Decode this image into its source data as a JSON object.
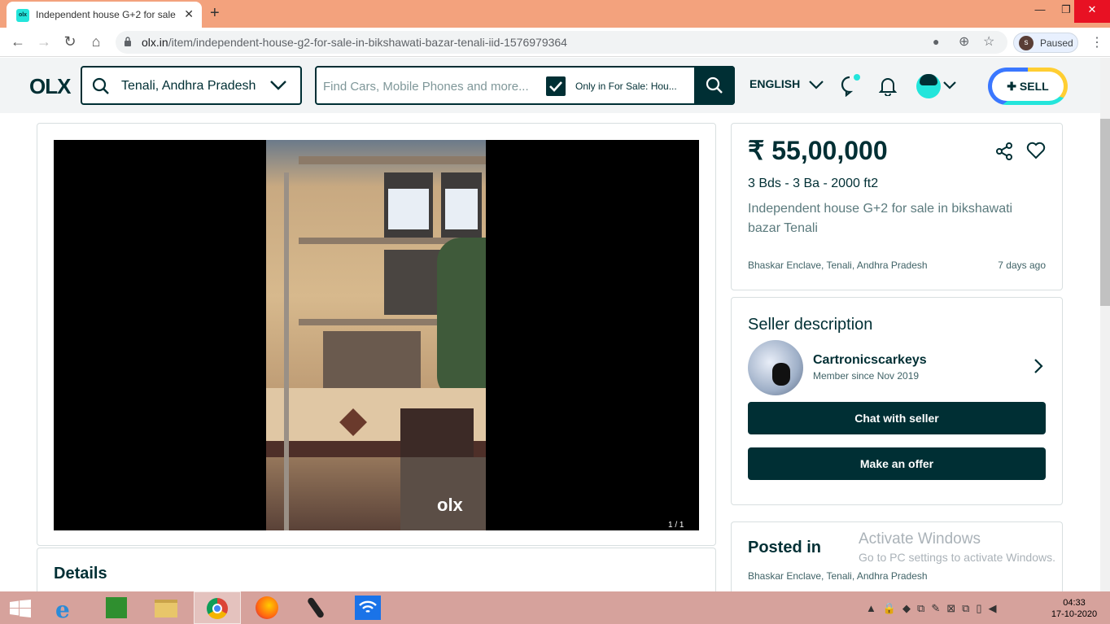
{
  "browser": {
    "tab_title": "Independent house G+2 for sale",
    "favicon_text": "olx",
    "url_host": "olx.in",
    "url_path": "/item/independent-house-g2-for-sale-in-bikshawati-bazar-tenali-iid-1576979364",
    "profile_initial": "s",
    "profile_status": "Paused"
  },
  "header": {
    "logo": "OLX",
    "location": "Tenali, Andhra Pradesh",
    "search_placeholder": "Find Cars, Mobile Phones and more...",
    "only_in_label": "Only in For Sale: Hou...",
    "language": "ENGLISH",
    "sell_label": "SELL"
  },
  "listing": {
    "photo_counter": "1 / 1",
    "watermark": "olx",
    "price": "₹ 55,00,000",
    "specs": "3 Bds - 3 Ba - 2000 ft2",
    "title": "Independent house G+2 for sale in bikshawati bazar Tenali",
    "location": "Bhaskar Enclave, Tenali, Andhra Pradesh",
    "posted_ago": "7 days ago",
    "details_heading": "Details"
  },
  "seller": {
    "heading": "Seller description",
    "name": "Cartronicscarkeys",
    "member_since": "Member since Nov 2019",
    "chat_button": "Chat with seller",
    "offer_button": "Make an offer"
  },
  "posted_in": {
    "heading": "Posted in",
    "location": "Bhaskar Enclave, Tenali, Andhra Pradesh"
  },
  "watermark": {
    "line1": "Activate Windows",
    "line2": "Go to PC settings to activate Windows."
  },
  "taskbar": {
    "time": "04:33",
    "date": "17-10-2020"
  }
}
